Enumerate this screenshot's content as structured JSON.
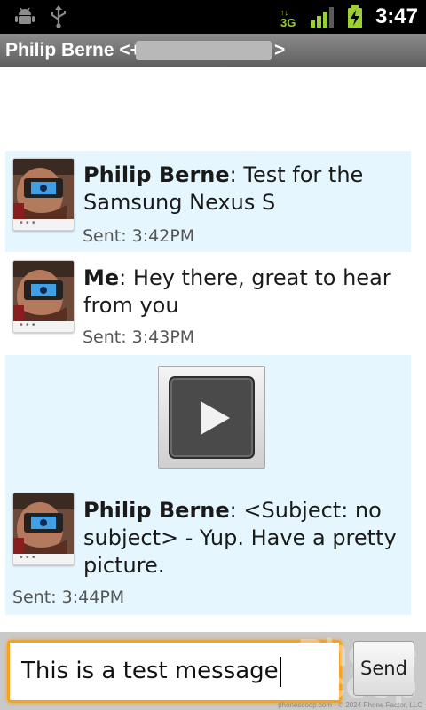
{
  "status_bar": {
    "time": "3:47",
    "network_type": "3G",
    "icons": [
      "android-debug-icon",
      "usb-icon",
      "3g-data-icon",
      "signal-strength-icon",
      "battery-charging-icon"
    ],
    "accent_green": "#9ccf31"
  },
  "titlebar": {
    "name": "Philip Berne <+",
    "address_end": ">"
  },
  "messages": [
    {
      "sender": "Philip Berne",
      "text": "Test for the Samsung Nexus S",
      "time": "Sent: 3:42PM"
    },
    {
      "sender": "Me",
      "text": "Hey there, great to hear from you",
      "time": "Sent: 3:43PM"
    },
    {
      "sender": "Philip Berne",
      "text": "<Subject: no subject> - Yup. Have a pretty picture.",
      "time": "Sent: 3:44PM",
      "attachment": "video"
    }
  ],
  "compose": {
    "text": "This is a test message",
    "send_label": "Send"
  },
  "watermark": {
    "line1": "Phone",
    "line2": "Scoop",
    "credit": "phonescoop.com · © 2024 Phone Factor, LLC"
  },
  "colors": {
    "incoming_bubble": "#e6f6ff",
    "focus_orange": "#f7a21c"
  }
}
